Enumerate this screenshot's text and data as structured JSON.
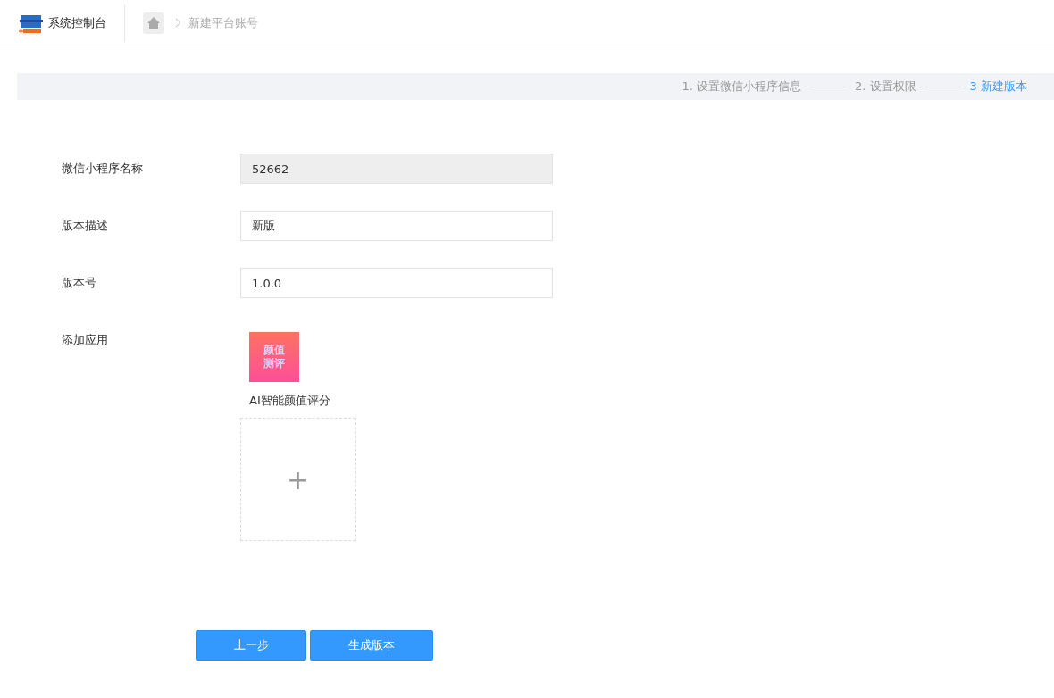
{
  "header": {
    "title": "系统控制台",
    "breadcrumb": "新建平台账号"
  },
  "steps": [
    {
      "label": "1. 设置微信小程序信息",
      "selected": false
    },
    {
      "label": "2. 设置权限",
      "selected": false
    },
    {
      "label": "3 新建版本",
      "selected": true
    }
  ],
  "form": [
    {
      "label": "微信小程序名称",
      "value": "52662",
      "disabled": true
    },
    {
      "label": "版本描述",
      "value": "新版",
      "disabled": false
    },
    {
      "label": "版本号",
      "value": "1.0.0",
      "disabled": false
    }
  ],
  "apps": {
    "label": "添加应用",
    "items": [
      {
        "icon_text": "颜值测评",
        "name": "AI智能颜值评分"
      }
    ],
    "add": "+"
  },
  "buttons": [
    {
      "label": "上一步"
    },
    {
      "label": "生成版本"
    }
  ]
}
